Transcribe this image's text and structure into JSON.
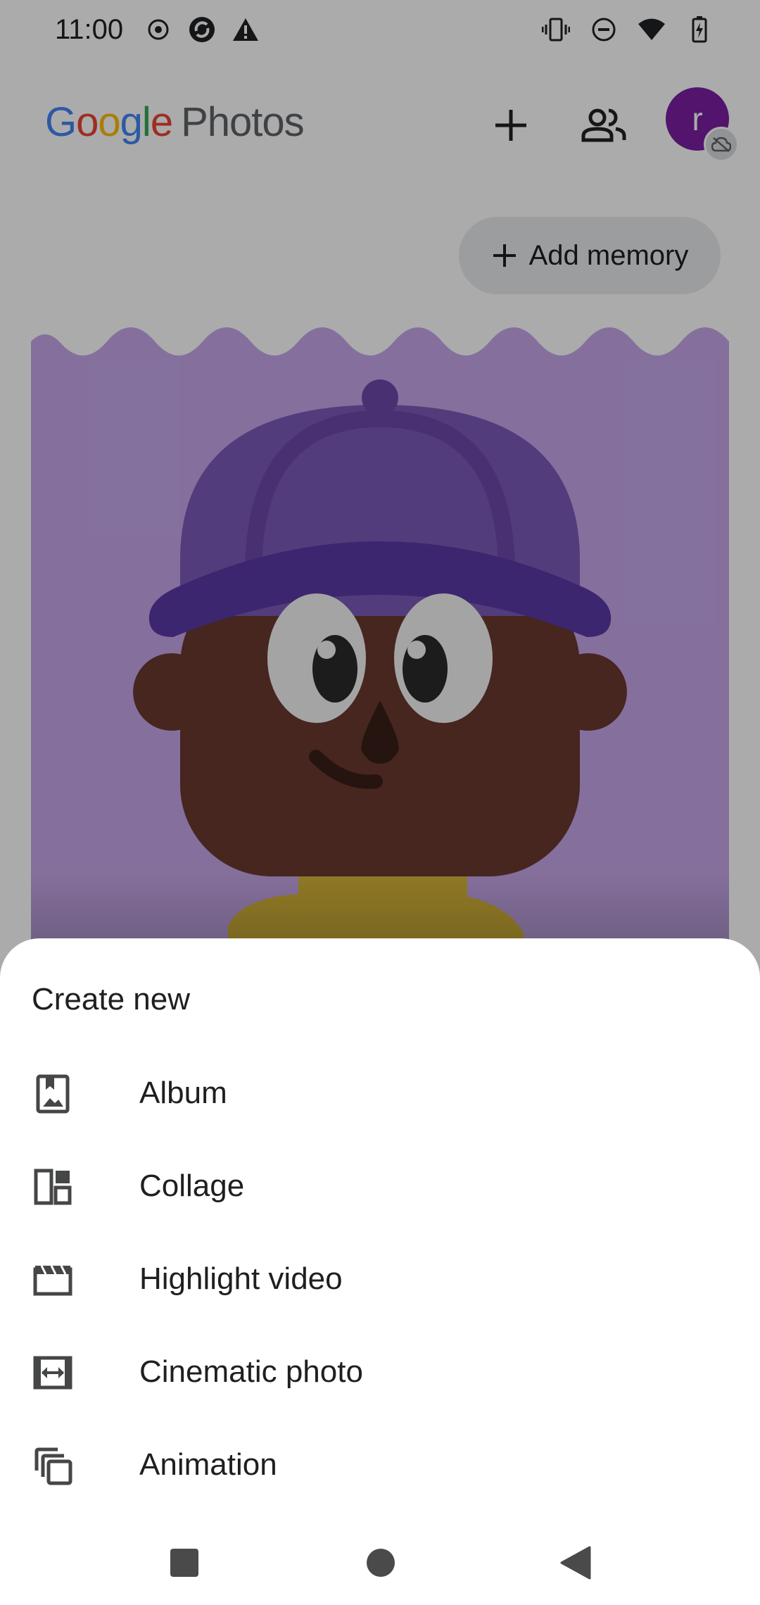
{
  "status_bar": {
    "time": "11:00",
    "left_icons": [
      "record-icon",
      "sync-icon",
      "warning-icon"
    ],
    "right_icons": [
      "vibrate-icon",
      "do-not-disturb-icon",
      "wifi-icon",
      "battery-charging-icon"
    ]
  },
  "app_bar": {
    "logo_letters": [
      "G",
      "o",
      "o",
      "g",
      "l",
      "e"
    ],
    "product_name": "Photos",
    "avatar_letter": "r"
  },
  "memories": {
    "add_memory_label": "Add memory"
  },
  "sheet": {
    "title": "Create new",
    "items": [
      {
        "label": "Album",
        "icon": "album-icon"
      },
      {
        "label": "Collage",
        "icon": "collage-icon"
      },
      {
        "label": "Highlight video",
        "icon": "movie-icon"
      },
      {
        "label": "Cinematic photo",
        "icon": "cinematic-icon"
      },
      {
        "label": "Animation",
        "icon": "animation-icon"
      }
    ]
  },
  "colors": {
    "avatar_bg": "#7b1fa2",
    "memory_bg": "#c7a8ea",
    "cap_purple": "#5a3aa6",
    "skin_dark": "#6a3a30"
  }
}
